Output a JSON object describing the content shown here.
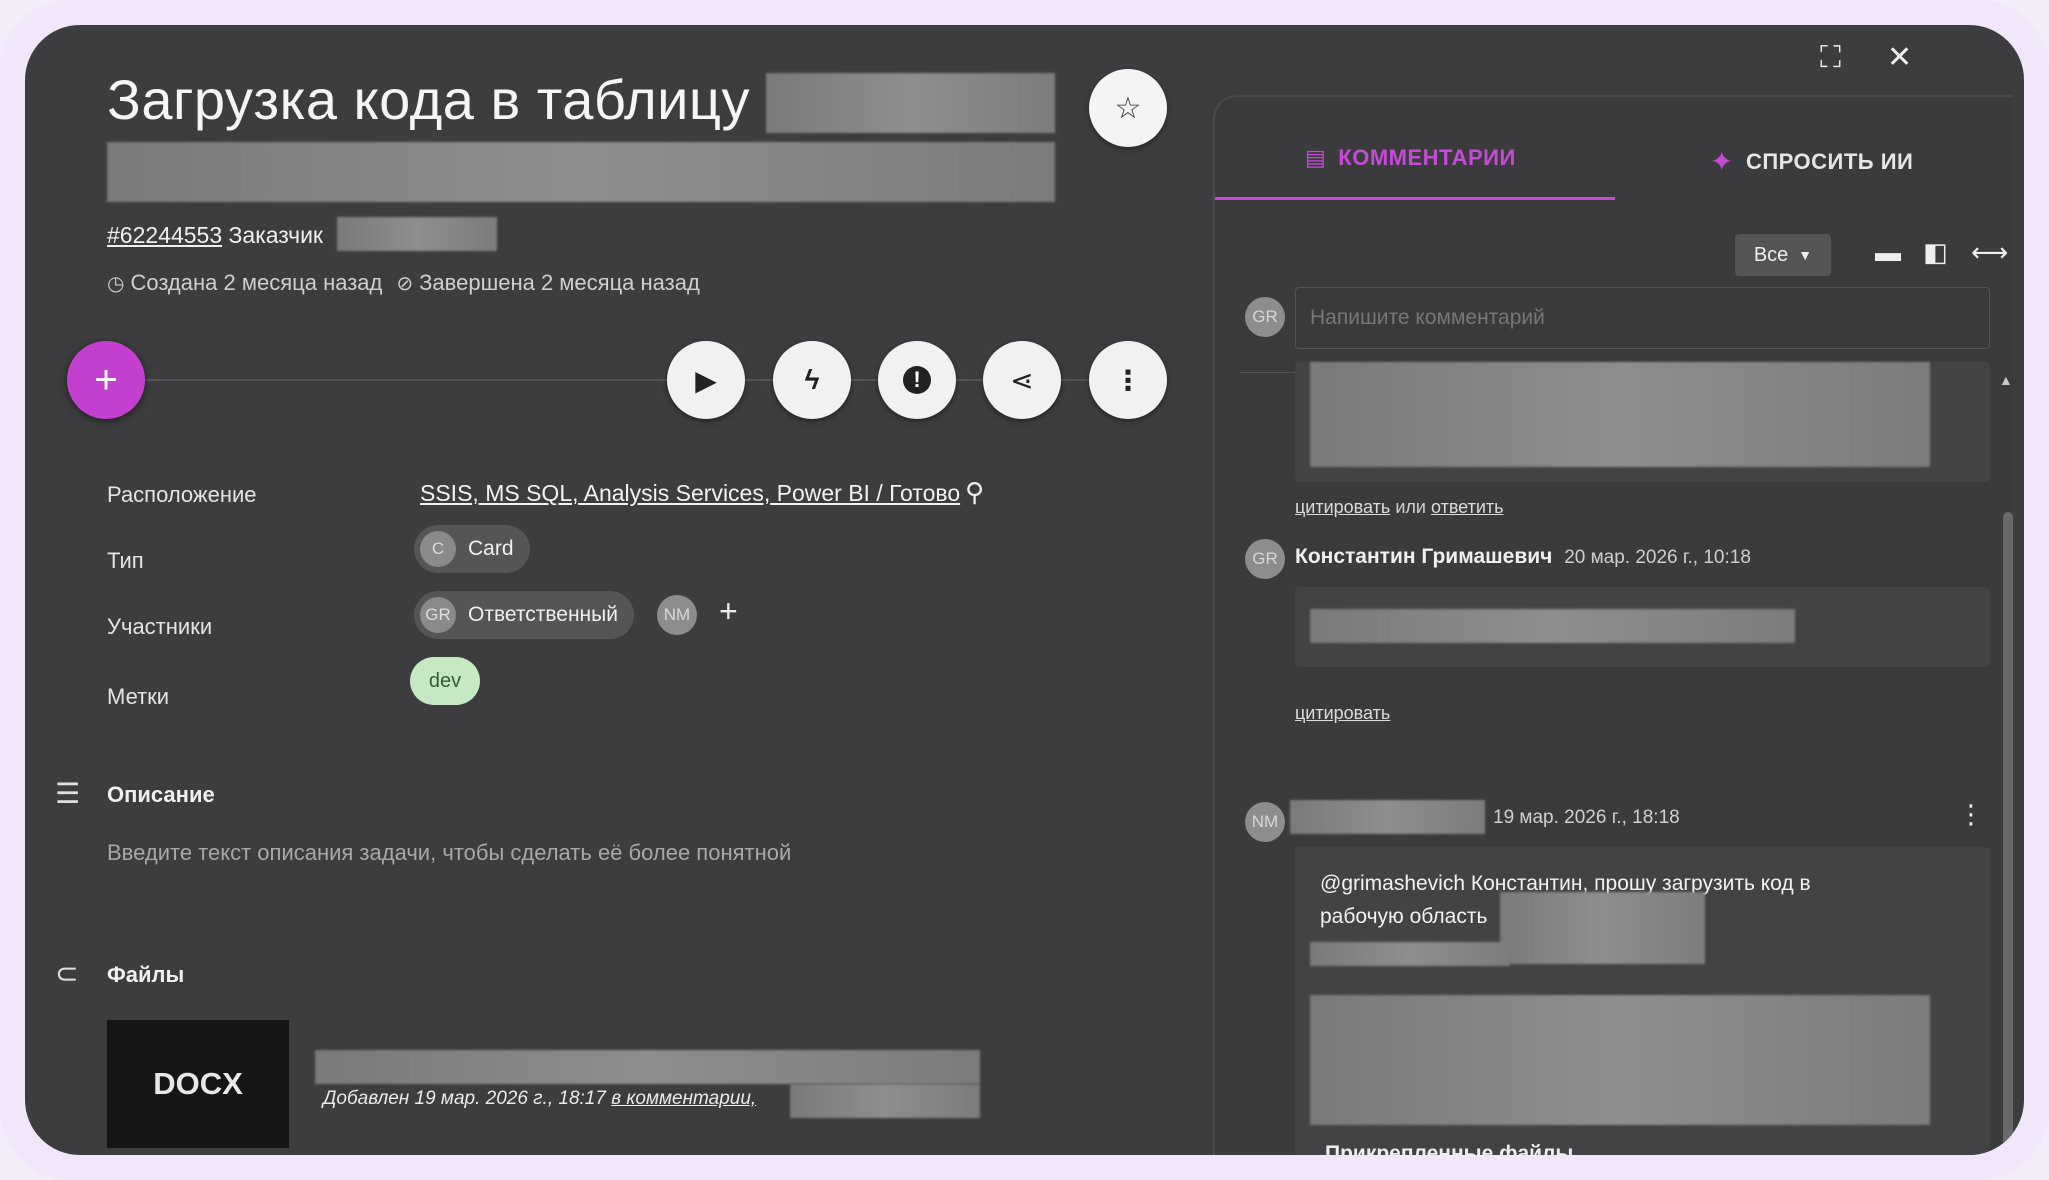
{
  "task": {
    "title": "Загрузка кода в таблицу",
    "number": "#62244553",
    "customer_label": "Заказчик",
    "created": "Создана 2 месяца назад",
    "completed": "Завершена 2 месяца назад"
  },
  "properties": {
    "location_label": "Расположение",
    "location_value": "SSIS, MS SQL, Analysis Services, Power BI / Готово",
    "type_label": "Тип",
    "type_value": "Card",
    "type_avatar": "C",
    "members_label": "Участники",
    "member_role": "Ответственный",
    "member_avatar1": "GR",
    "member_avatar2": "NM",
    "tags_label": "Метки",
    "tag_value": "dev"
  },
  "description": {
    "title": "Описание",
    "placeholder": "Введите текст описания задачи, чтобы сделать её более понятной"
  },
  "files": {
    "title": "Файлы",
    "file_type": "DOCX",
    "added_text": "Добавлен 19 мар. 2026 г., 18:17",
    "added_link": "в комментарии,"
  },
  "panel": {
    "tab_comments": "КОММЕНТАРИИ",
    "tab_ai": "СПРОСИТЬ ИИ",
    "filter_value": "Все",
    "input_avatar": "GR",
    "input_placeholder": "Напишите комментарий",
    "comment1_quote": "цитировать",
    "comment1_or": "или",
    "comment1_reply": "ответить",
    "comment2_avatar": "GR",
    "comment2_author": "Константин Гримашевич",
    "comment2_date": "20 мар. 2026 г., 10:18",
    "comment2_quote": "цитировать",
    "comment3_avatar": "NM",
    "comment3_date": "19 мар. 2026 г., 18:18",
    "comment3_text": "@grimashevich Константин, прошу загрузить код в рабочую область",
    "attached_files": "Прикрепленные файлы"
  },
  "colors": {
    "background": "#3d3d3f",
    "accent": "#c33fd0",
    "tag_dev": "#c6e9c3"
  }
}
